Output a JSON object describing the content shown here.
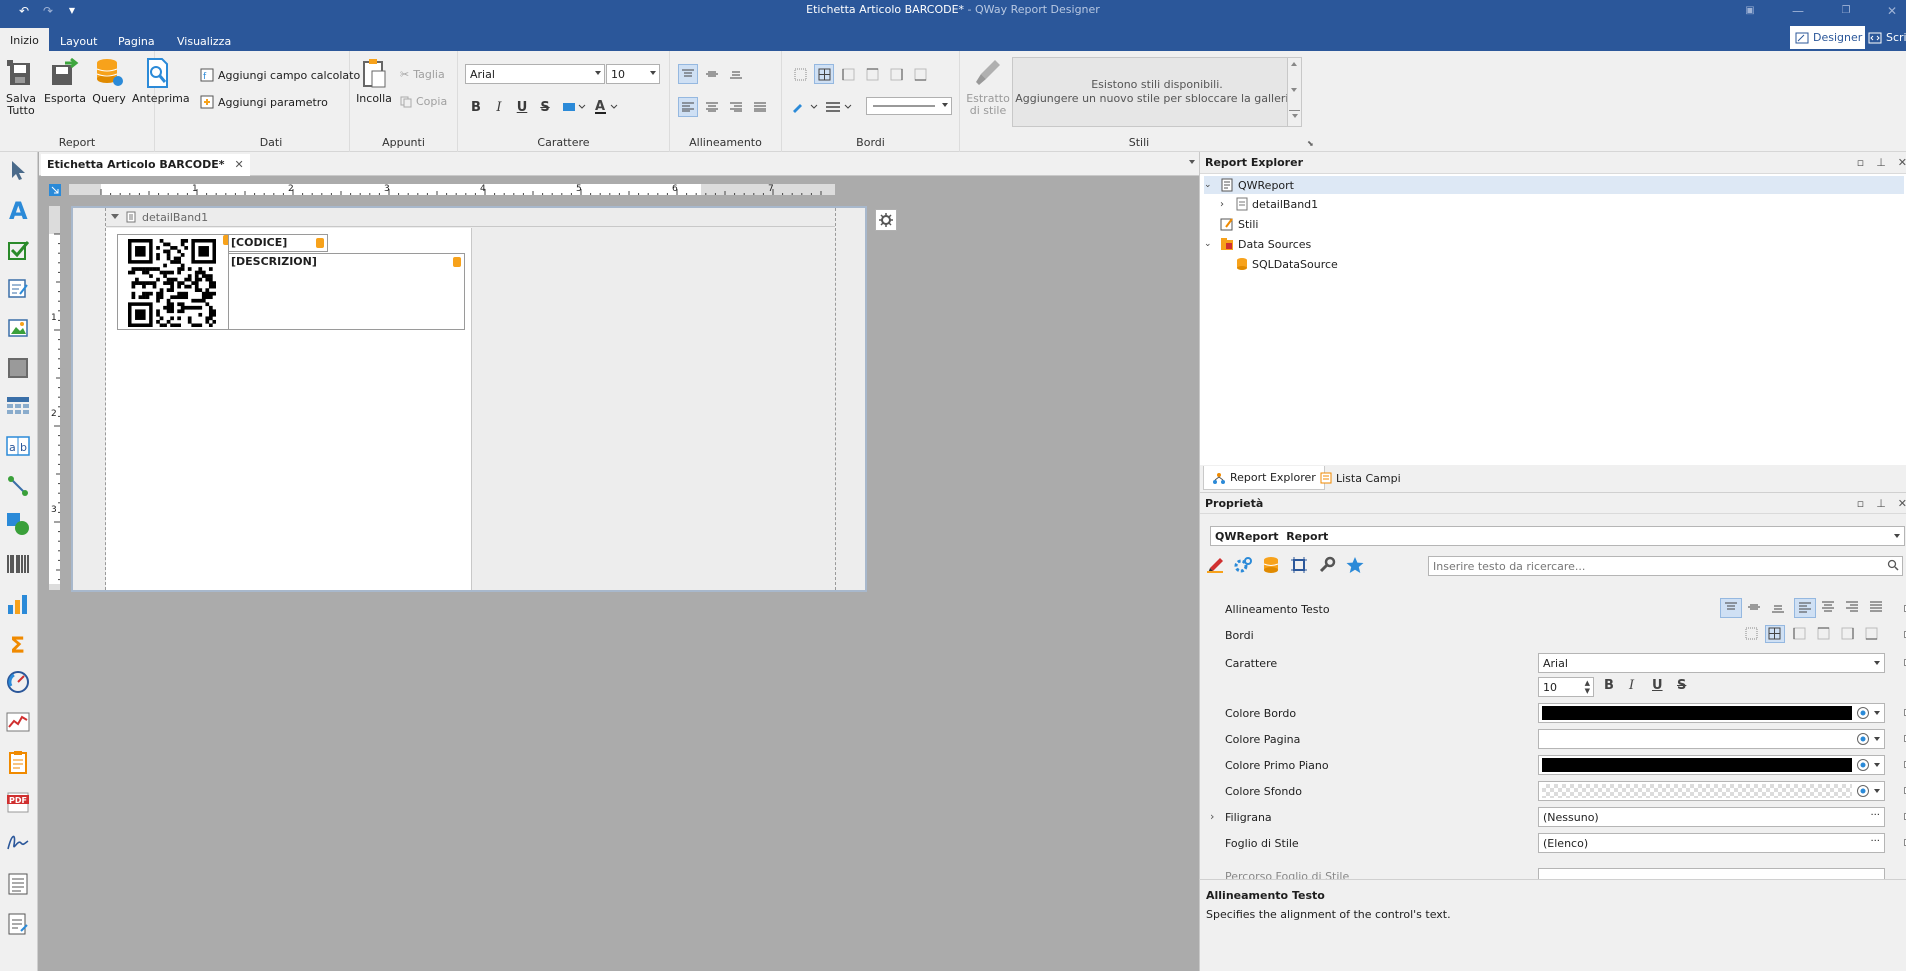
{
  "window": {
    "doc_title": "Etichetta Articolo BARCODE*",
    "separator": " - ",
    "app_name": "QWay Report Designer"
  },
  "menu_tabs": [
    "Inizio",
    "Layout",
    "Pagina",
    "Visualizza"
  ],
  "mode_buttons": {
    "designer": "Designer",
    "script": "Scrip"
  },
  "ribbon": {
    "report": {
      "label": "Report",
      "salva1": "Salva",
      "salva2": "Tutto",
      "esporta": "Esporta",
      "query": "Query",
      "anteprima": "Anteprima"
    },
    "dati": {
      "label": "Dati",
      "campo": "Aggiungi campo calcolato",
      "parametro": "Aggiungi parametro"
    },
    "appunti": {
      "label": "Appunti",
      "incolla": "Incolla",
      "taglia": "Taglia",
      "copia": "Copia"
    },
    "carattere": {
      "label": "Carattere",
      "font": "Arial",
      "size": "10"
    },
    "allineamento": {
      "label": "Allineamento"
    },
    "bordi": {
      "label": "Bordi"
    },
    "stili": {
      "label": "Stili",
      "estratto1": "Estratto",
      "estratto2": "di stile",
      "gallery1": "Esistono stili disponibili.",
      "gallery2": "Aggiungere un nuovo stile per sbloccare la galleria."
    }
  },
  "document_tab": "Etichetta Articolo BARCODE*",
  "designer": {
    "band": "detailBand1",
    "field_codice": "[CODICE]",
    "field_descrizione": "[DESCRIZION]",
    "ruler_h": [
      "1",
      "2",
      "3",
      "4",
      "5",
      "6",
      "7"
    ],
    "ruler_v": [
      "1",
      "2",
      "3"
    ]
  },
  "report_explorer": {
    "title": "Report Explorer",
    "tree": [
      "QWReport",
      "detailBand1",
      "Stili",
      "Data Sources",
      "SQLDataSource"
    ],
    "tabs": [
      "Report Explorer",
      "Lista Campi"
    ]
  },
  "properties": {
    "title": "Proprietà",
    "object_name": "QWReport",
    "object_type": "Report",
    "search_placeholder": "Inserire testo da ricercare...",
    "rows": {
      "allineamento": "Allineamento Testo",
      "bordi": "Bordi",
      "carattere": "Carattere",
      "carattere_val": "Arial",
      "size_val": "10",
      "colore_bordo": "Colore Bordo",
      "colore_pagina": "Colore Pagina",
      "colore_primo": "Colore Primo Piano",
      "colore_sfondo": "Colore Sfondo",
      "filigrana": "Filigrana",
      "filigrana_val": "(Nessuno)",
      "foglio": "Foglio di Stile",
      "foglio_val": "(Elenco)",
      "percorso": "Percorso Foglio di Stile"
    },
    "colors": {
      "bordo": "#000000",
      "pagina": "#ffffff",
      "primo": "#000000"
    },
    "description_title": "Allineamento Testo",
    "description_text": "Specifies the alignment of the control's text."
  },
  "theme": {
    "accent": "#2b579a"
  }
}
